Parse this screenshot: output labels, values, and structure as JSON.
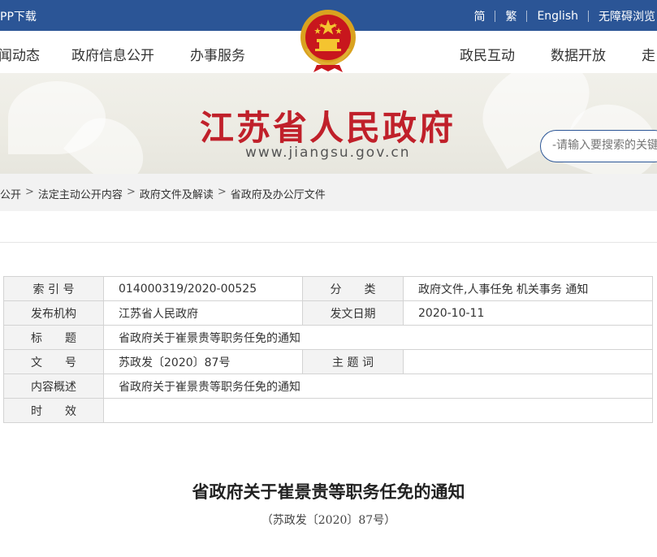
{
  "topbar": {
    "app_download": "PP下载",
    "links": [
      "简",
      "繁",
      "English",
      "无障碍浏览"
    ]
  },
  "nav": {
    "items": [
      "闻动态",
      "政府信息公开",
      "办事服务",
      "政民互动",
      "数据开放",
      "走"
    ]
  },
  "banner": {
    "title": "江苏省人民政府",
    "url": "www.jiangsu.gov.cn",
    "search_placeholder": "-请输入要搜索的关键"
  },
  "colors": {
    "topbar": "#2b5596",
    "title_red": "#c0202a"
  },
  "breadcrumb": [
    "公开",
    "法定主动公开内容",
    "政府文件及解读",
    "省政府及办公厅文件"
  ],
  "breadcrumb_separator": ">",
  "info": {
    "index_label": "索 引 号",
    "index_value": "014000319/2020-00525",
    "category_label": "分　　类",
    "category_value": "政府文件,人事任免 机关事务 通知",
    "issuer_label": "发布机构",
    "issuer_value": "江苏省人民政府",
    "date_label": "发文日期",
    "date_value": "2020-10-11",
    "title_label": "标　　题",
    "title_value": "省政府关于崔景贵等职务任免的通知",
    "docno_label": "文　　号",
    "docno_value": "苏政发〔2020〕87号",
    "keywords_label": "主 题 词",
    "keywords_value": "",
    "summary_label": "内容概述",
    "summary_value": "省政府关于崔景贵等职务任免的通知",
    "validity_label": "时　　效",
    "validity_value": ""
  },
  "document": {
    "title": "省政府关于崔景贵等职务任免的通知",
    "number": "（苏政发〔2020〕87号）"
  }
}
